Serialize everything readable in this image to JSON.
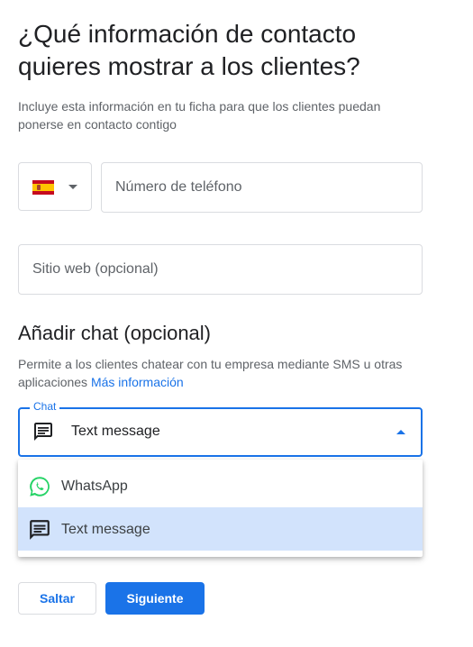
{
  "header": {
    "title": "¿Qué información de contacto quieres mostrar a los clientes?",
    "subtitle": "Incluye esta información en tu ficha para que los clientes puedan ponerse en contacto contigo"
  },
  "phone": {
    "country_flag": "spain-flag",
    "placeholder": "Número de teléfono"
  },
  "website": {
    "placeholder": "Sitio web (opcional)"
  },
  "chat_section": {
    "title": "Añadir chat (opcional)",
    "description": "Permite a los clientes chatear con tu empresa mediante SMS u otras aplicaciones",
    "link": "Más información",
    "field_label": "Chat",
    "selected_value": "Text message",
    "options": [
      {
        "label": "WhatsApp",
        "icon": "whatsapp-icon"
      },
      {
        "label": "Text message",
        "icon": "sms-icon",
        "selected": true
      }
    ]
  },
  "buttons": {
    "skip": "Saltar",
    "next": "Siguiente"
  },
  "colors": {
    "accent": "#1a73e8",
    "selected_option_bg": "#d2e3fc",
    "whatsapp": "#25d366"
  }
}
